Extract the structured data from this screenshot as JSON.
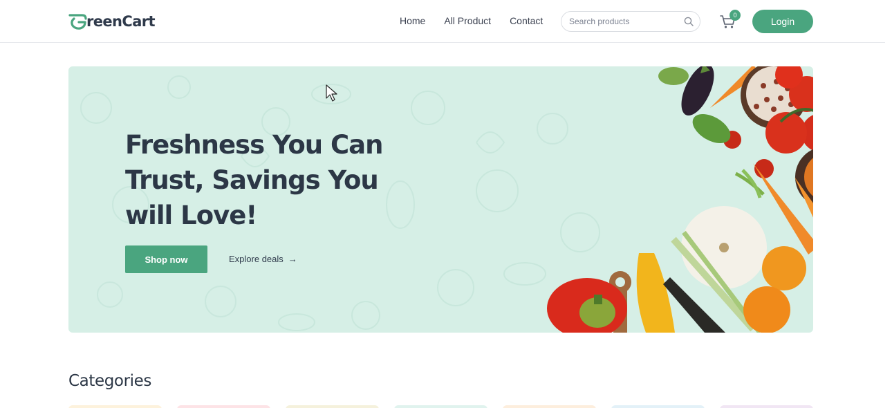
{
  "header": {
    "logo_text_prefix": "G",
    "logo_text_rest": "reenCart",
    "nav": [
      "Home",
      "All Product",
      "Contact"
    ],
    "search_placeholder": "Search products",
    "cart_count": "0",
    "login_label": "Login"
  },
  "hero": {
    "title_line1": "Freshness You Can",
    "title_line2": "Trust, Savings You",
    "title_line3": "will Love!",
    "shop_label": "Shop now",
    "explore_label": "Explore deals",
    "explore_arrow": "→"
  },
  "categories": {
    "title": "Categories",
    "card_colors": [
      "#fdf2dc",
      "#fde3e6",
      "#f5f1dc",
      "#e0f3ee",
      "#fdeedd",
      "#e3f1f8",
      "#f1e6f4"
    ]
  },
  "colors": {
    "accent": "#4aa57f",
    "hero_bg": "#d6efe6",
    "text_dark": "#2c3746"
  }
}
